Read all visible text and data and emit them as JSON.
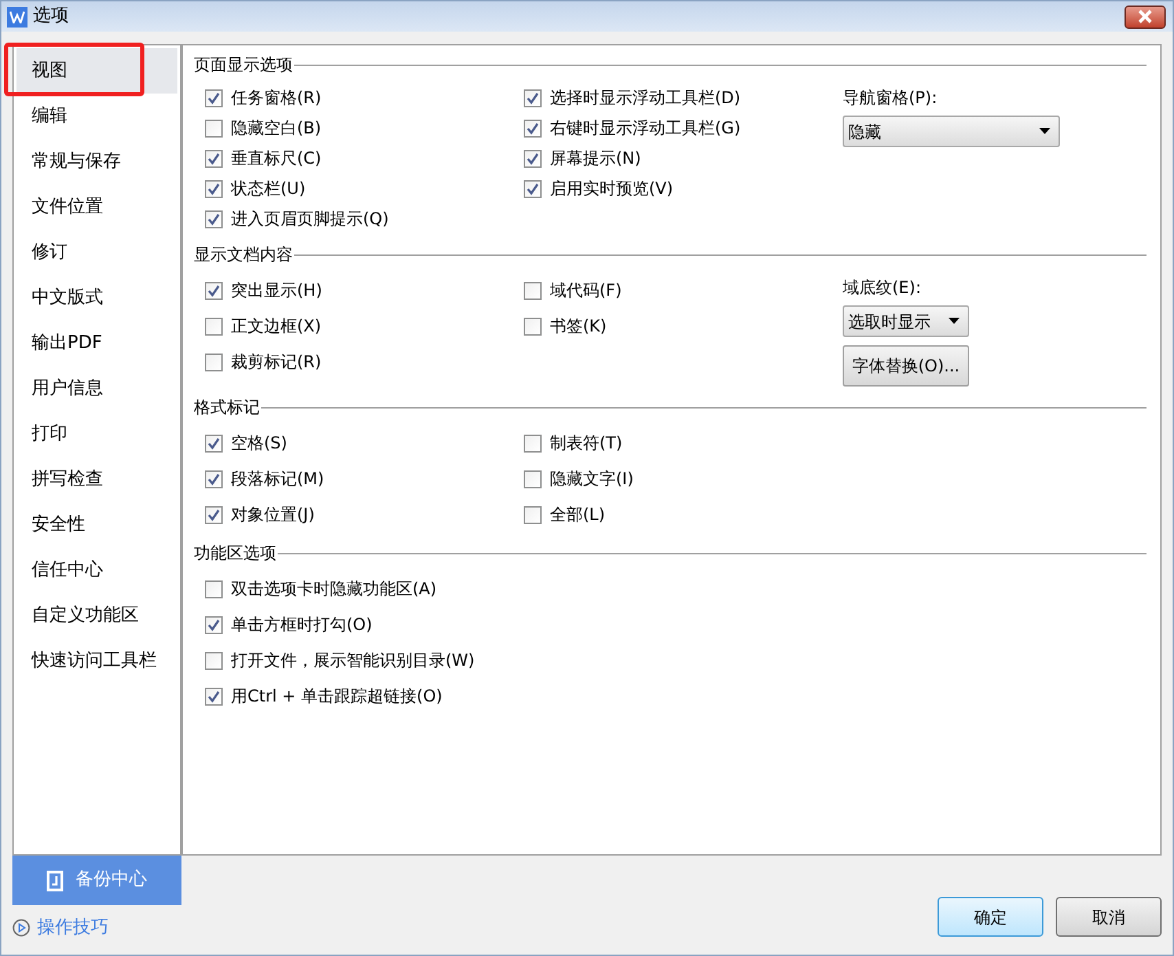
{
  "window": {
    "title": "选项"
  },
  "sidebar": {
    "items": [
      {
        "label": "视图",
        "selected": true,
        "highlighted": true
      },
      {
        "label": "编辑",
        "selected": false,
        "highlighted": false
      },
      {
        "label": "常规与保存",
        "selected": false,
        "highlighted": false
      },
      {
        "label": "文件位置",
        "selected": false,
        "highlighted": false
      },
      {
        "label": "修订",
        "selected": false,
        "highlighted": false
      },
      {
        "label": "中文版式",
        "selected": false,
        "highlighted": false
      },
      {
        "label": "输出PDF",
        "selected": false,
        "highlighted": false
      },
      {
        "label": "用户信息",
        "selected": false,
        "highlighted": false
      },
      {
        "label": "打印",
        "selected": false,
        "highlighted": false
      },
      {
        "label": "拼写检查",
        "selected": false,
        "highlighted": false
      },
      {
        "label": "安全性",
        "selected": false,
        "highlighted": false
      },
      {
        "label": "信任中心",
        "selected": false,
        "highlighted": false
      },
      {
        "label": "自定义功能区",
        "selected": false,
        "highlighted": false
      },
      {
        "label": "快速访问工具栏",
        "selected": false,
        "highlighted": false
      }
    ],
    "backup_button": "备份中心",
    "tips_link": "操作技巧"
  },
  "sections": [
    {
      "title": "页面显示选项",
      "columns": [
        [
          {
            "label": "任务窗格(R)",
            "checked": true
          },
          {
            "label": "隐藏空白(B)",
            "checked": false
          },
          {
            "label": "垂直标尺(C)",
            "checked": true
          },
          {
            "label": "状态栏(U)",
            "checked": true
          },
          {
            "label": "进入页眉页脚提示(Q)",
            "checked": true
          }
        ],
        [
          {
            "label": "选择时显示浮动工具栏(D)",
            "checked": true
          },
          {
            "label": "右键时显示浮动工具栏(G)",
            "checked": true
          },
          {
            "label": "屏幕提示(N)",
            "checked": true
          },
          {
            "label": "启用实时预览(V)",
            "checked": true
          }
        ]
      ],
      "side": [
        {
          "kind": "label",
          "text": "导航窗格(P):"
        },
        {
          "kind": "dropdown",
          "value": "隐藏"
        }
      ]
    },
    {
      "title": "显示文档内容",
      "columns": [
        [
          {
            "label": "突出显示(H)",
            "checked": true
          },
          {
            "label": "正文边框(X)",
            "checked": false
          },
          {
            "label": "裁剪标记(R)",
            "checked": false
          }
        ],
        [
          {
            "label": "域代码(F)",
            "checked": false
          },
          {
            "label": "书签(K)",
            "checked": false
          }
        ]
      ],
      "side": [
        {
          "kind": "label",
          "text": "域底纹(E):"
        },
        {
          "kind": "dropdown",
          "value": "选取时显示"
        },
        {
          "kind": "button",
          "text": "字体替换(O)..."
        }
      ]
    },
    {
      "title": "格式标记",
      "columns": [
        [
          {
            "label": "空格(S)",
            "checked": true
          },
          {
            "label": "段落标记(M)",
            "checked": true
          },
          {
            "label": "对象位置(J)",
            "checked": true
          }
        ],
        [
          {
            "label": "制表符(T)",
            "checked": false
          },
          {
            "label": "隐藏文字(I)",
            "checked": false
          },
          {
            "label": "全部(L)",
            "checked": false
          }
        ]
      ]
    },
    {
      "title": "功能区选项",
      "columns": [
        [
          {
            "label": "双击选项卡时隐藏功能区(A)",
            "checked": false
          },
          {
            "label": "单击方框时打勾(O)",
            "checked": true
          },
          {
            "label": "打开文件，展示智能识别目录(W)",
            "checked": false
          },
          {
            "label": "用Ctrl + 单击跟踪超链接(O)",
            "checked": true
          }
        ]
      ]
    }
  ],
  "buttons": [
    {
      "label": "确定",
      "default": true
    },
    {
      "label": "取消",
      "default": false
    }
  ]
}
